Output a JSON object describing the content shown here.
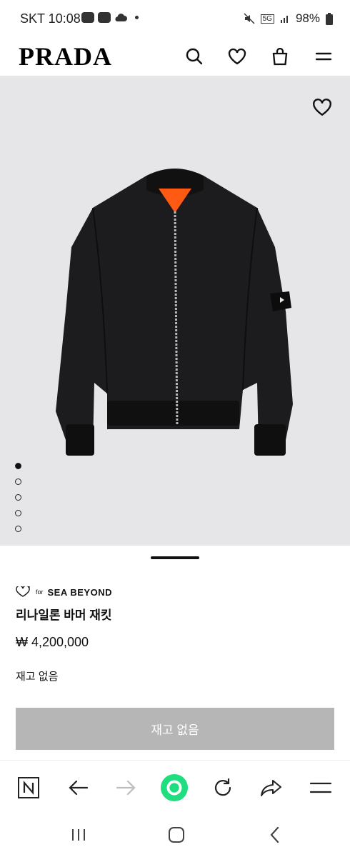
{
  "status_bar": {
    "carrier_time": "SKT 10:08",
    "network": "5G",
    "battery": "98%"
  },
  "header": {
    "logo": "PRADA",
    "icons": [
      "search-icon",
      "heart-icon",
      "bag-icon",
      "menu-icon"
    ]
  },
  "gallery": {
    "image_count": 5,
    "active_index": 0,
    "favorite_icon": "heart-icon"
  },
  "product": {
    "brand_for": "for",
    "brand_name": "SEA BEYOND",
    "name": "리나일론 바머 재킷",
    "price": "₩ 4,200,000",
    "stock_status": "재고 없음",
    "button_label": "재고 없음"
  },
  "browser_toolbar": {
    "icons": [
      "naver-icon",
      "back-arrow-icon",
      "forward-arrow-icon",
      "home-circle-icon",
      "refresh-icon",
      "share-icon",
      "menu-icon"
    ],
    "accent_color": "#1ede7f"
  },
  "system_nav": {
    "icons": [
      "recent-apps-icon",
      "home-icon",
      "back-icon"
    ]
  }
}
